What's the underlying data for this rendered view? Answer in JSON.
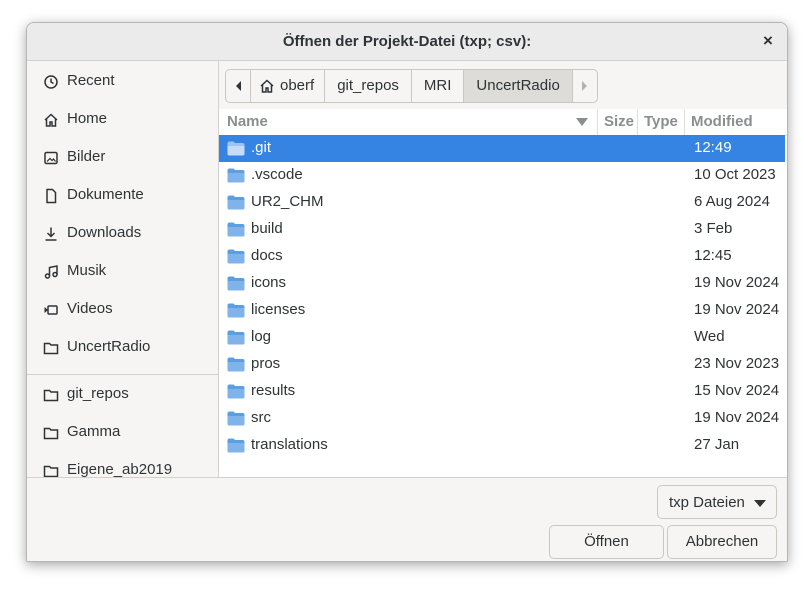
{
  "window": {
    "title": "Öffnen der Projekt-Datei (txp; csv):",
    "close_label": "×"
  },
  "sidebar": {
    "items": [
      {
        "label": "Recent",
        "icon": "clock-icon"
      },
      {
        "label": "Home",
        "icon": "home-icon"
      },
      {
        "label": "Bilder",
        "icon": "image-icon"
      },
      {
        "label": "Dokumente",
        "icon": "document-icon"
      },
      {
        "label": "Downloads",
        "icon": "download-icon"
      },
      {
        "label": "Musik",
        "icon": "music-icon"
      },
      {
        "label": "Videos",
        "icon": "video-icon"
      },
      {
        "label": "UncertRadio",
        "icon": "folder-icon"
      }
    ],
    "bookmarks": [
      {
        "label": "git_repos",
        "icon": "folder-icon"
      },
      {
        "label": "Gamma",
        "icon": "folder-icon"
      },
      {
        "label": "Eigene_ab2019",
        "icon": "folder-icon"
      }
    ]
  },
  "pathbar": {
    "segments": [
      "oberf",
      "git_repos",
      "MRI",
      "UncertRadio"
    ],
    "active": "UncertRadio"
  },
  "columns": {
    "name": "Name",
    "size": "Size",
    "type": "Type",
    "modified": "Modified"
  },
  "files": [
    {
      "name": ".git",
      "modified": "12:49",
      "selected": true
    },
    {
      "name": ".vscode",
      "modified": "10 Oct 2023"
    },
    {
      "name": "UR2_CHM",
      "modified": "6 Aug 2024"
    },
    {
      "name": "build",
      "modified": "3 Feb"
    },
    {
      "name": "docs",
      "modified": "12:45"
    },
    {
      "name": "icons",
      "modified": "19 Nov 2024"
    },
    {
      "name": "licenses",
      "modified": "19 Nov 2024"
    },
    {
      "name": "log",
      "modified": "Wed"
    },
    {
      "name": "pros",
      "modified": "23 Nov 2023"
    },
    {
      "name": "results",
      "modified": "15 Nov 2024"
    },
    {
      "name": "src",
      "modified": "19 Nov 2024"
    },
    {
      "name": "translations",
      "modified": "27 Jan"
    }
  ],
  "filter": {
    "selected": "txp Dateien"
  },
  "buttons": {
    "open": "Öffnen",
    "cancel": "Abbrechen"
  },
  "colors": {
    "selection": "#3584e4",
    "folder": "#5c9fe0"
  }
}
